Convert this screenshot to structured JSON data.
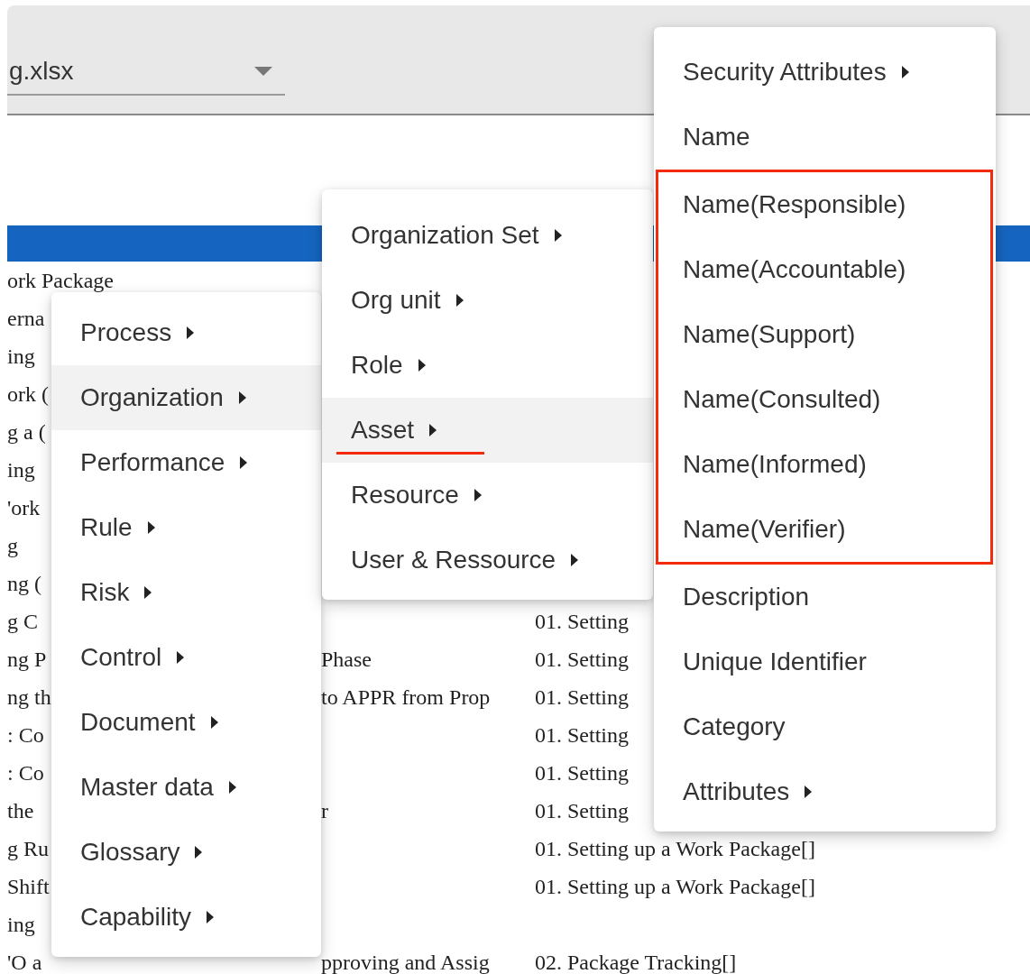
{
  "file_select": {
    "value": "g.xlsx"
  },
  "table": {
    "rows": [
      {
        "column_1": "ork Package",
        "column_2": "",
        "column_3": ""
      },
      {
        "column_1": "erna",
        "column_2": "",
        "column_3": ""
      },
      {
        "column_1": "ing",
        "column_2": "",
        "column_3": ""
      },
      {
        "column_1": "ork (",
        "column_2": "",
        "column_3": ""
      },
      {
        "column_1": "g a (",
        "column_2": "",
        "column_3": ""
      },
      {
        "column_1": "ing",
        "column_2": "",
        "column_3": ""
      },
      {
        "column_1": "'ork",
        "column_2": "",
        "column_3": ""
      },
      {
        "column_1": "g",
        "column_2": "",
        "column_3": ""
      },
      {
        "column_1": "ng (",
        "column_2": "",
        "column_3": ""
      },
      {
        "column_1": "g C",
        "column_2": "",
        "column_3": "01. Setting"
      },
      {
        "column_1": "ng P",
        "column_2": "Phase",
        "column_3": "01. Setting"
      },
      {
        "column_1": "ng th",
        "column_2": "to APPR from Prop",
        "column_3": "01. Setting"
      },
      {
        "column_1": ": Co",
        "column_2": "",
        "column_3": "01. Setting"
      },
      {
        "column_1": ": Co",
        "column_2": "",
        "column_3": "01. Setting"
      },
      {
        "column_1": " the",
        "column_2": "r",
        "column_3": "01. Setting"
      },
      {
        "column_1": "g Ru",
        "column_2": "",
        "column_3": "01. Setting up a Work Package[]"
      },
      {
        "column_1": "Shift",
        "column_2": "",
        "column_3": "01. Setting up a Work Package[]"
      },
      {
        "column_1": "ing",
        "column_2": "",
        "column_3": ""
      },
      {
        "column_1": "'O a",
        "column_2": "pproving and Assig",
        "column_3": "02. Package Tracking[]"
      }
    ]
  },
  "menus": [
    {
      "groups": [
        {
          "boxed": false,
          "items": [
            {
              "label": "Process",
              "has_submenu": true,
              "selected": false,
              "underlined": false
            },
            {
              "label": "Organization",
              "has_submenu": true,
              "selected": true,
              "underlined": false
            },
            {
              "label": "Performance",
              "has_submenu": true,
              "selected": false,
              "underlined": false
            },
            {
              "label": "Rule",
              "has_submenu": true,
              "selected": false,
              "underlined": false
            },
            {
              "label": "Risk",
              "has_submenu": true,
              "selected": false,
              "underlined": false
            },
            {
              "label": "Control",
              "has_submenu": true,
              "selected": false,
              "underlined": false
            },
            {
              "label": "Document",
              "has_submenu": true,
              "selected": false,
              "underlined": false
            },
            {
              "label": "Master data",
              "has_submenu": true,
              "selected": false,
              "underlined": false
            },
            {
              "label": "Glossary",
              "has_submenu": true,
              "selected": false,
              "underlined": false
            },
            {
              "label": "Capability",
              "has_submenu": true,
              "selected": false,
              "underlined": false
            }
          ]
        }
      ]
    },
    {
      "groups": [
        {
          "boxed": false,
          "items": [
            {
              "label": "Organization Set",
              "has_submenu": true,
              "selected": false,
              "underlined": false
            },
            {
              "label": "Org unit",
              "has_submenu": true,
              "selected": false,
              "underlined": false
            },
            {
              "label": "Role",
              "has_submenu": true,
              "selected": false,
              "underlined": false
            },
            {
              "label": "Asset",
              "has_submenu": true,
              "selected": true,
              "underlined": true
            },
            {
              "label": "Resource",
              "has_submenu": true,
              "selected": false,
              "underlined": false
            },
            {
              "label": "User & Ressource",
              "has_submenu": true,
              "selected": false,
              "underlined": false
            }
          ]
        }
      ]
    },
    {
      "groups": [
        {
          "boxed": false,
          "items": [
            {
              "label": "Security Attributes",
              "has_submenu": true,
              "selected": false,
              "underlined": false
            },
            {
              "label": "Name",
              "has_submenu": false,
              "selected": false,
              "underlined": false
            }
          ]
        },
        {
          "boxed": true,
          "items": [
            {
              "label": "Name(Responsible)",
              "has_submenu": false,
              "selected": false,
              "underlined": false
            },
            {
              "label": "Name(Accountable)",
              "has_submenu": false,
              "selected": false,
              "underlined": false
            },
            {
              "label": "Name(Support)",
              "has_submenu": false,
              "selected": false,
              "underlined": false
            },
            {
              "label": "Name(Consulted)",
              "has_submenu": false,
              "selected": false,
              "underlined": false
            },
            {
              "label": "Name(Informed)",
              "has_submenu": false,
              "selected": false,
              "underlined": false
            },
            {
              "label": "Name(Verifier)",
              "has_submenu": false,
              "selected": false,
              "underlined": false
            }
          ]
        },
        {
          "boxed": false,
          "items": [
            {
              "label": "Description",
              "has_submenu": false,
              "selected": false,
              "underlined": false
            },
            {
              "label": "Unique Identifier",
              "has_submenu": false,
              "selected": false,
              "underlined": false
            },
            {
              "label": "Category",
              "has_submenu": false,
              "selected": false,
              "underlined": false
            },
            {
              "label": "Attributes",
              "has_submenu": true,
              "selected": false,
              "underlined": false
            }
          ]
        }
      ]
    }
  ]
}
